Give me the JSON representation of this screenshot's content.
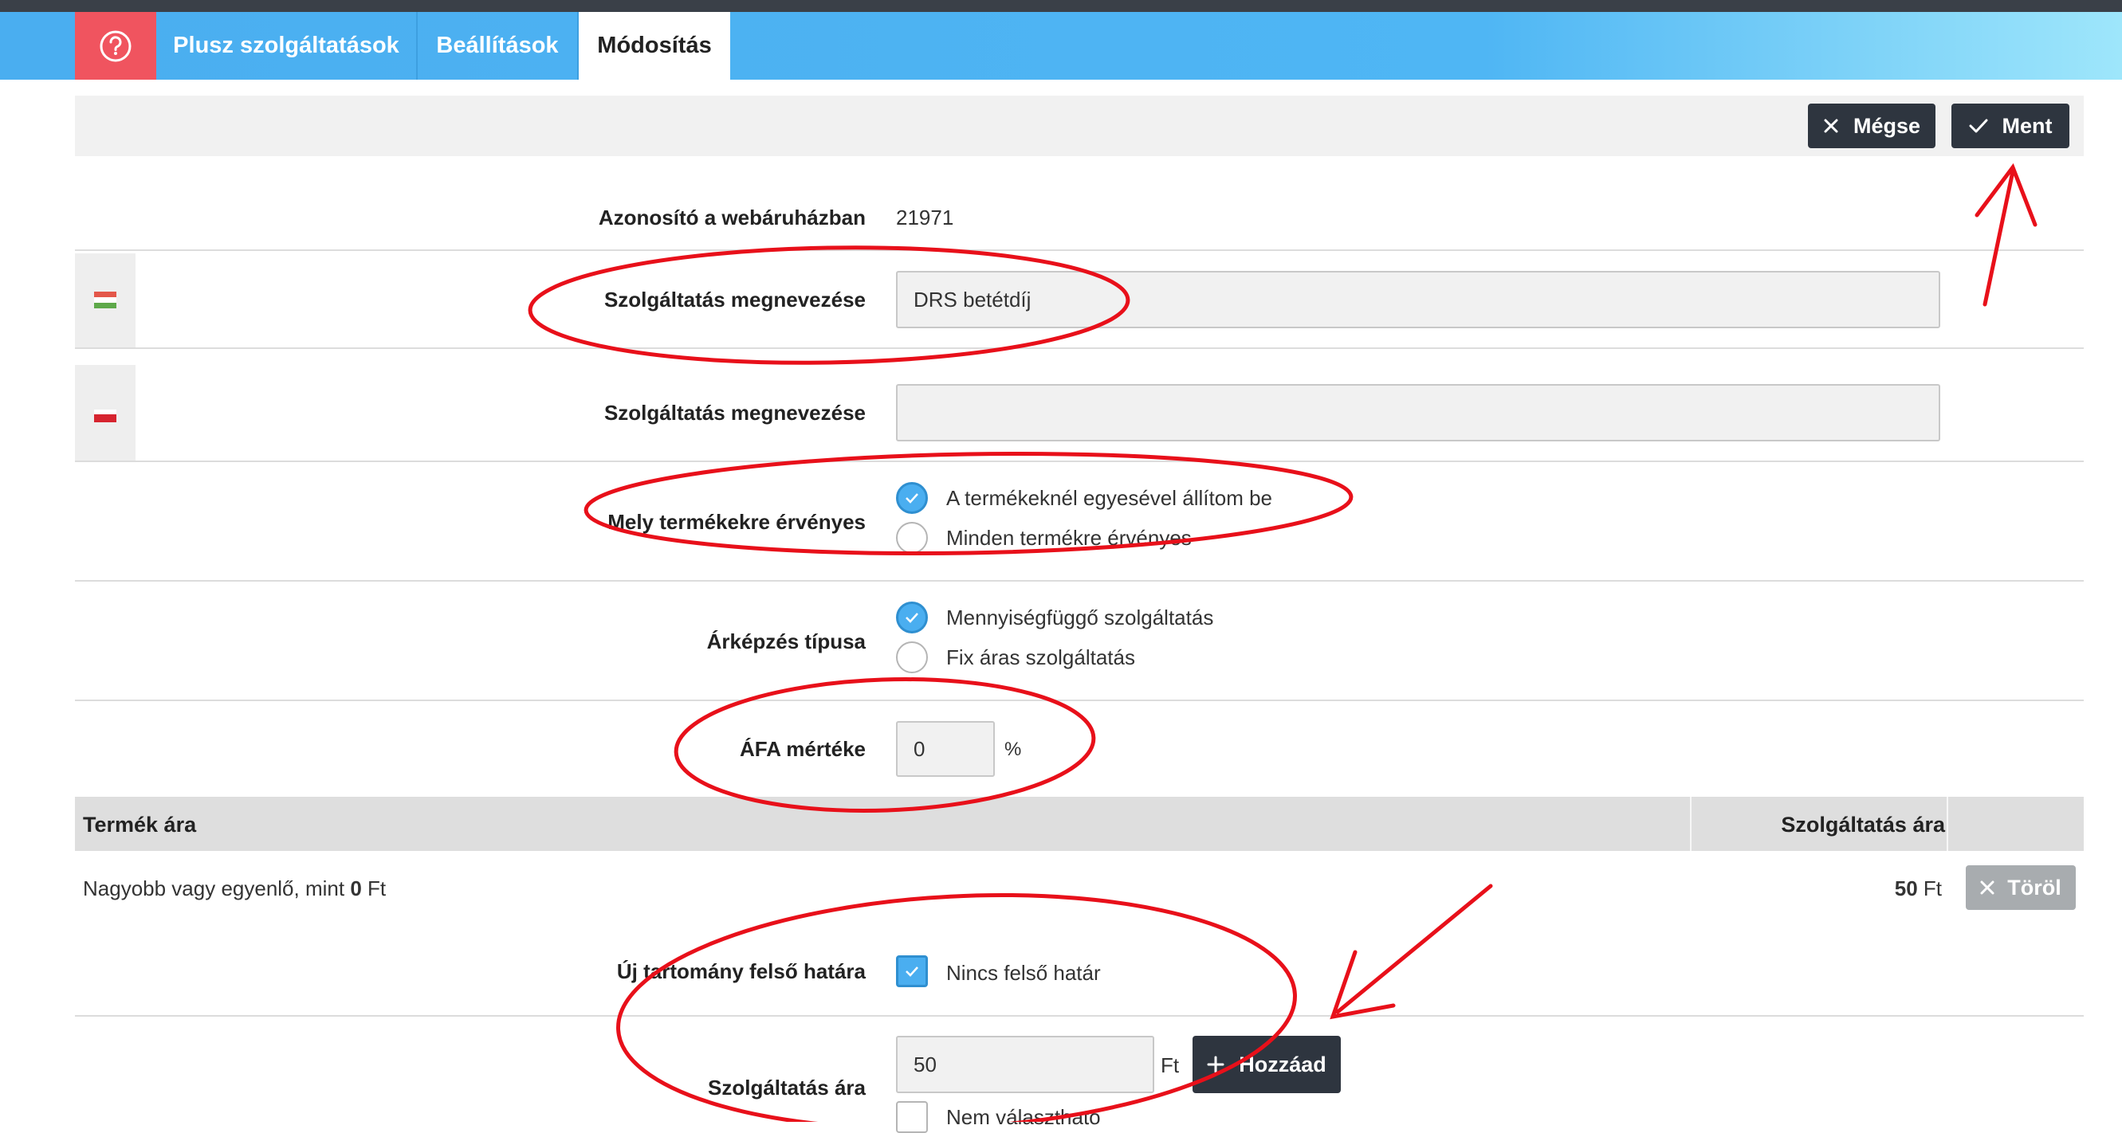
{
  "nav": {
    "help_icon": "question-circle-icon",
    "tabs": [
      {
        "label": "Plusz szolgáltatások"
      },
      {
        "label": "Beállítások"
      },
      {
        "label": "Módosítás"
      }
    ]
  },
  "toolbar": {
    "cancel_label": "Mégse",
    "save_label": "Ment"
  },
  "form": {
    "id_label": "Azonosító a webáruházban",
    "id_value": "21971",
    "name_label_hu": "Szolgáltatás megnevezése",
    "name_value_hu": "DRS betétdíj",
    "name_label_2": "Szolgáltatás megnevezése",
    "name_value_2": "",
    "applies_label": "Mely termékekre érvényes",
    "applies_options": [
      "A termékeknél egyesével állítom be",
      "Minden termékre érvényes"
    ],
    "pricing_label": "Árképzés típusa",
    "pricing_options": [
      "Mennyiségfüggő szolgáltatás",
      "Fix áras szolgáltatás"
    ],
    "vat_label": "ÁFA mértéke",
    "vat_value": "0",
    "vat_unit": "%"
  },
  "price_table": {
    "col_product_price": "Termék ára",
    "col_service_price": "Szolgáltatás ára",
    "row": {
      "condition_prefix": "Nagyobb vagy egyenlő, mint ",
      "condition_amount": "0",
      "condition_unit": " Ft",
      "service_amount": "50",
      "service_unit": " Ft",
      "delete_label": "Töröl"
    }
  },
  "new_range": {
    "upper_label": "Új tartomány felső határa",
    "no_upper_label": "Nincs felső határ",
    "service_price_label": "Szolgáltatás ára",
    "service_price_value": "50",
    "currency": "Ft",
    "add_label": "Hozzáad",
    "not_selectable_label": "Nem választható"
  },
  "colors": {
    "nav_blue": "#4fb6f4",
    "help_red": "#f0545f",
    "dark_button": "#2e353f",
    "annotation_red": "#e8101a"
  }
}
